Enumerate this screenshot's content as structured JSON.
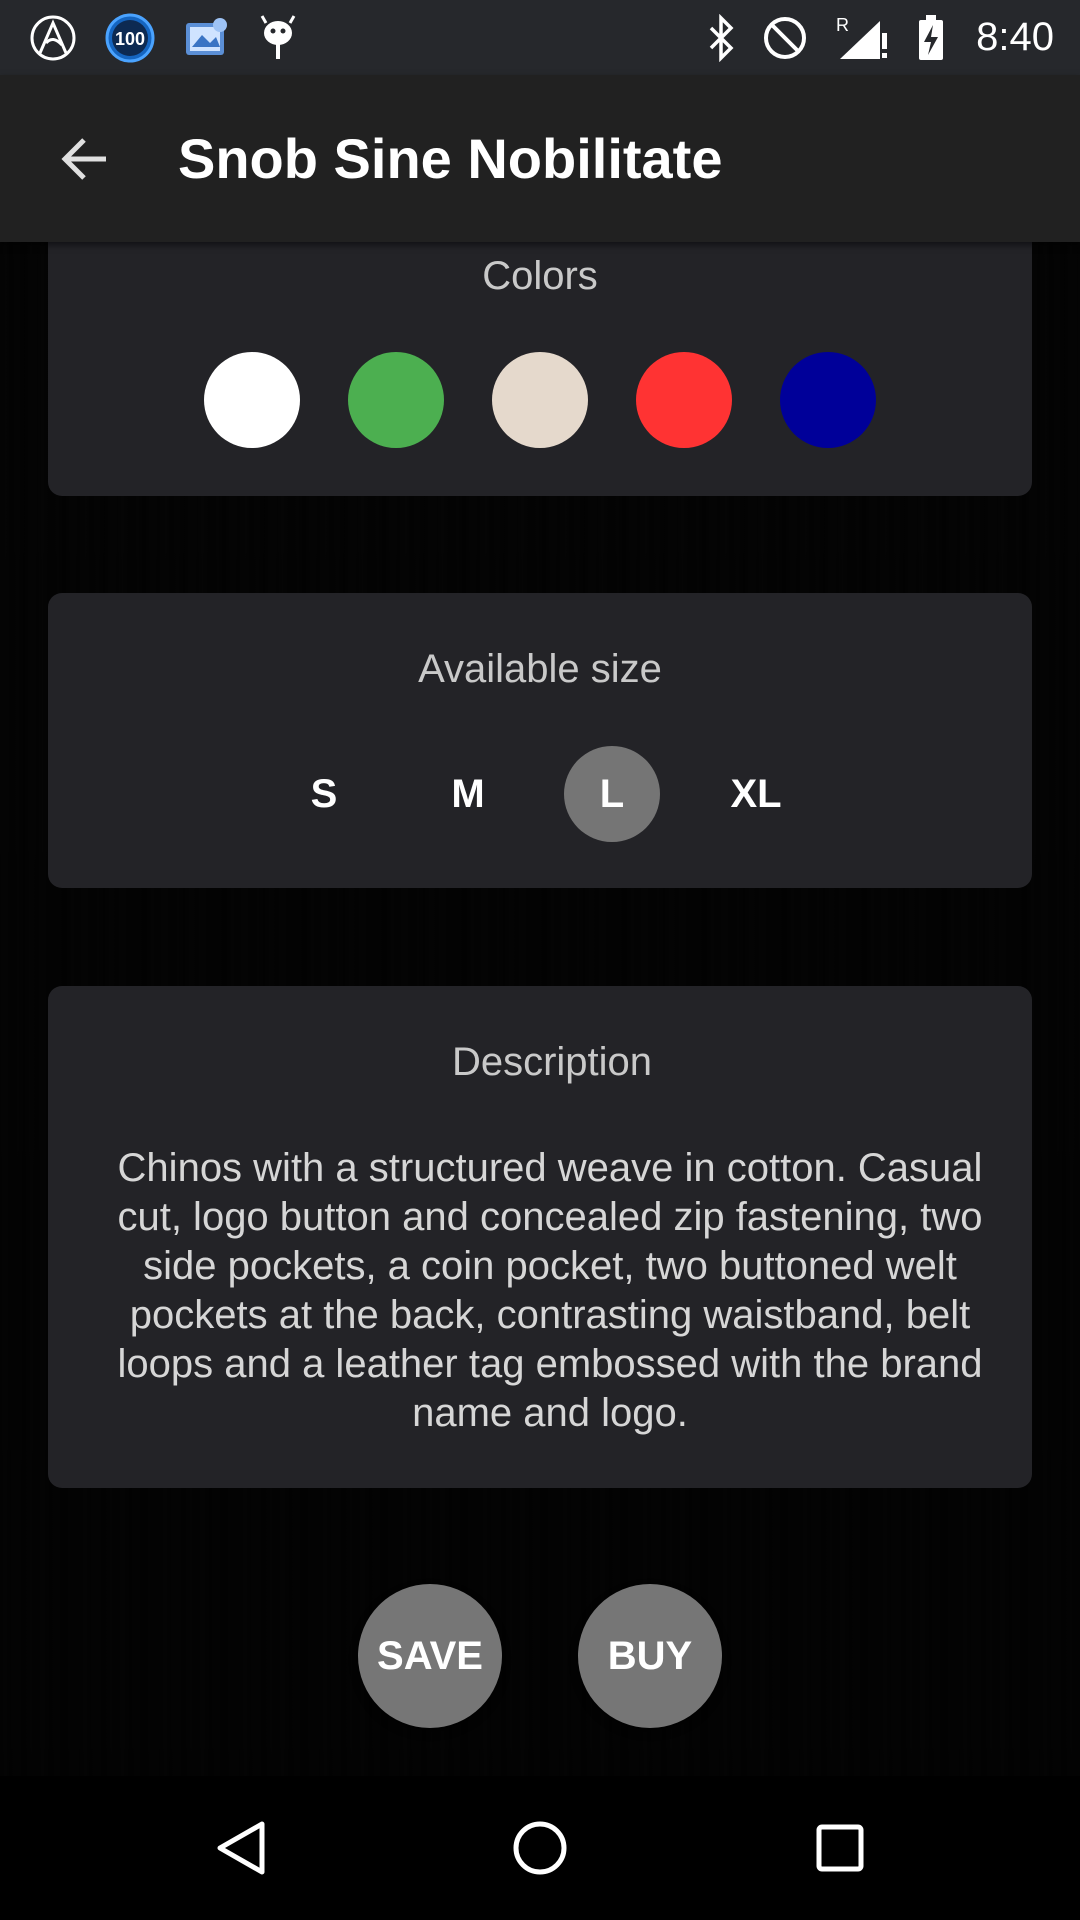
{
  "status_bar": {
    "time": "8:40",
    "left_icons": [
      "app-launcher-icon",
      "battery-100-icon",
      "photo-app-icon",
      "android-debug-icon"
    ],
    "battery_badge": "100",
    "roaming_mark": "R",
    "right_icons": [
      "bluetooth-icon",
      "do-not-disturb-icon",
      "signal-icon",
      "battery-charging-icon"
    ]
  },
  "app_bar": {
    "title": "Snob Sine Nobilitate",
    "back_icon": "arrow-back-icon"
  },
  "colors": {
    "title": "Colors",
    "swatches": [
      "#ffffff",
      "#4caf50",
      "#e5d9cc",
      "#ff3333",
      "#000099"
    ]
  },
  "sizes": {
    "title": "Available size",
    "options": [
      "S",
      "M",
      "L",
      "XL"
    ],
    "selected": "L"
  },
  "description": {
    "title": "Description",
    "text": "Chinos with a structured weave in cotton. Casual cut, logo button and concealed zip fastening, two side pockets, a coin pocket, two buttoned welt pockets at the back, contrasting waistband, belt loops and a leather tag embossed with the brand name and logo."
  },
  "actions": {
    "save_label": "SAVE",
    "buy_label": "BUY"
  },
  "nav_bar": {
    "icons": [
      "back-triangle-icon",
      "home-circle-icon",
      "recents-square-icon"
    ]
  }
}
